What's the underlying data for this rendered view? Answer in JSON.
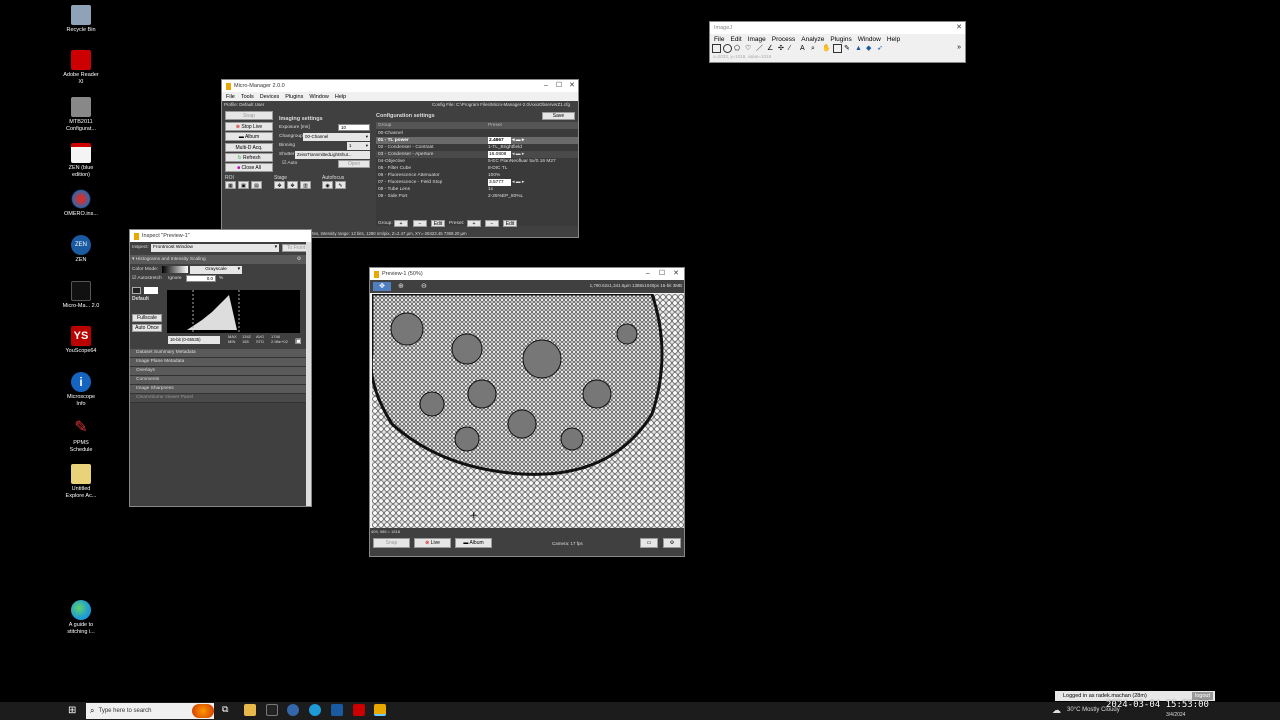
{
  "desktop_icons": [
    {
      "label": "Recycle Bin",
      "icon": "recycle-bin-icon",
      "color": "#9ab"
    },
    {
      "label": "Adobe Reader XI",
      "icon": "adobe-reader-icon",
      "color": "#c00"
    },
    {
      "label": "MTB2011 Configurat...",
      "icon": "mtb-config-icon",
      "color": "#777"
    },
    {
      "label": "ZEN (blue edition)",
      "icon": "zen-blue-icon",
      "color": "#fff"
    },
    {
      "label": "OMERO.ins...",
      "icon": "omero-icon",
      "color": "#336"
    },
    {
      "label": "ZEN",
      "icon": "zen-icon",
      "color": "#1a5aa0"
    },
    {
      "label": "Micro-Ma... 2.0",
      "icon": "micromanager-icon",
      "color": "#222"
    },
    {
      "label": "YouScope64",
      "icon": "youscope-icon",
      "color": "#b00"
    },
    {
      "label": "Microscope Info",
      "icon": "info-icon",
      "color": "#1565c0"
    },
    {
      "label": "PPMS Schedule",
      "icon": "ppms-icon",
      "color": "#d33"
    },
    {
      "label": "Untitled Explore Ac...",
      "icon": "document-icon",
      "color": "#e8d27a"
    },
    {
      "label": "A guide to stitching i...",
      "icon": "edge-icon",
      "color": "#1e9bd7"
    }
  ],
  "imagej": {
    "title": "ImageJ",
    "menu": [
      "File",
      "Edit",
      "Image",
      "Process",
      "Analyze",
      "Plugins",
      "Window",
      "Help"
    ],
    "status": "x=2033, y=1016, value=1018"
  },
  "mm": {
    "title": "Micro-Manager 2.0.0",
    "menu": [
      "File",
      "Tools",
      "Devices",
      "Plugins",
      "Window",
      "Help"
    ],
    "profile": "Profile: Default User",
    "config_file": "Config File: C:\\Program Files\\Micro-Manager-2.0\\AxioObserverZ1.cfg",
    "buttons": [
      "Snap",
      "Stop Live",
      "Album",
      "Multi-D Acq.",
      "Refresh",
      "Close All"
    ],
    "imaging_settings": "Imaging settings",
    "exposure_label": "Exposure [ms]",
    "exposure_value": "10",
    "changroup_label": "Changroup",
    "changroup_value": "00-Channel",
    "binning_label": "Binning",
    "binning_value": "1",
    "shutter_label": "Shutter",
    "shutter_value": "ZeissTransmittedLightShut...",
    "auto_label": "Auto",
    "open_label": "Open",
    "roi_label": "ROI",
    "stage_label": "Stage",
    "autofocus_label": "Autofocus",
    "config_title": "Configuration settings",
    "save_label": "Save",
    "col_group": "Group",
    "col_preset": "Preset",
    "config_rows": [
      {
        "group": "00-Channel",
        "preset": ""
      },
      {
        "group": "01 - TL power",
        "preset": "2.4667"
      },
      {
        "group": "02 - Condenser - Contrast",
        "preset": "1-TL_Brightfield"
      },
      {
        "group": "03 - Condenser - Aperture",
        "preset": "16.0808"
      },
      {
        "group": "04-Objective",
        "preset": "5-EC PlanNeofluar 5x/0.16 M27"
      },
      {
        "group": "05 - Filter Cube",
        "preset": "8-DIC TL"
      },
      {
        "group": "06 - Fluorescence Attenuator",
        "preset": "100%"
      },
      {
        "group": "07 - Fluorescence - Field Stop",
        "preset": "3.5777"
      },
      {
        "group": "08 - Tube Lens",
        "preset": "1x"
      },
      {
        "group": "09 - Side Port",
        "preset": "2-25%EP_80%L"
      }
    ],
    "group_label": "Group:",
    "preset_label": "Preset:",
    "edit_label": "Edit",
    "status": "Image info (from camera): 1388 X 1040 X 2 bytes, Intensity range: 12 bits, 1280 nm/pix, Z=2.47 µm, XY=-28423.45 7369.20 µm"
  },
  "inspect": {
    "title": "Inspect \"Preview-1\"",
    "inspect_label": "Inspect:",
    "inspect_value": "Frontmost Window",
    "to_front": "To Front",
    "histo_section": "Histograms and Intensity Scaling",
    "color_mode_label": "Color Mode:",
    "color_mode_value": "Grayscale",
    "autostretch": "Autostretch",
    "ignore": "Ignore",
    "ignore_value": "0.0",
    "pct": "%",
    "default_label": "Default",
    "fullscale": "Fullscale",
    "auto_once": "Auto Once",
    "bitdepth": "16-bit (0-65535)",
    "max_min": "MAX MIN",
    "max_val": "1342 165",
    "avg_std": "AVG STD",
    "avg_val": "1748 2.98e+02",
    "sections": [
      "Dataset Summary Metadata",
      "Image Plane Metadata",
      "Overlays",
      "Comments",
      "Image Sharpness",
      "ClearVolume Viewer Panel"
    ]
  },
  "preview": {
    "title": "Preview-1 (50%)",
    "info": "1,790.52x1,341.6µm  1388x1040px  16-bit 3MB",
    "coords": "409, 985 = 1518",
    "snap": "Snap",
    "live": "Live",
    "album": "Album",
    "camera": "Camera: 17 fps"
  },
  "notification": {
    "text": "Logged in as radek.machan (28m)",
    "logout": "logout"
  },
  "taskbar": {
    "search_placeholder": "Type here to search",
    "weather": "30°C  Mostly Cloudy",
    "date": "3/4/2024",
    "clock_overlay": "2024-03-04  15:53:00"
  }
}
